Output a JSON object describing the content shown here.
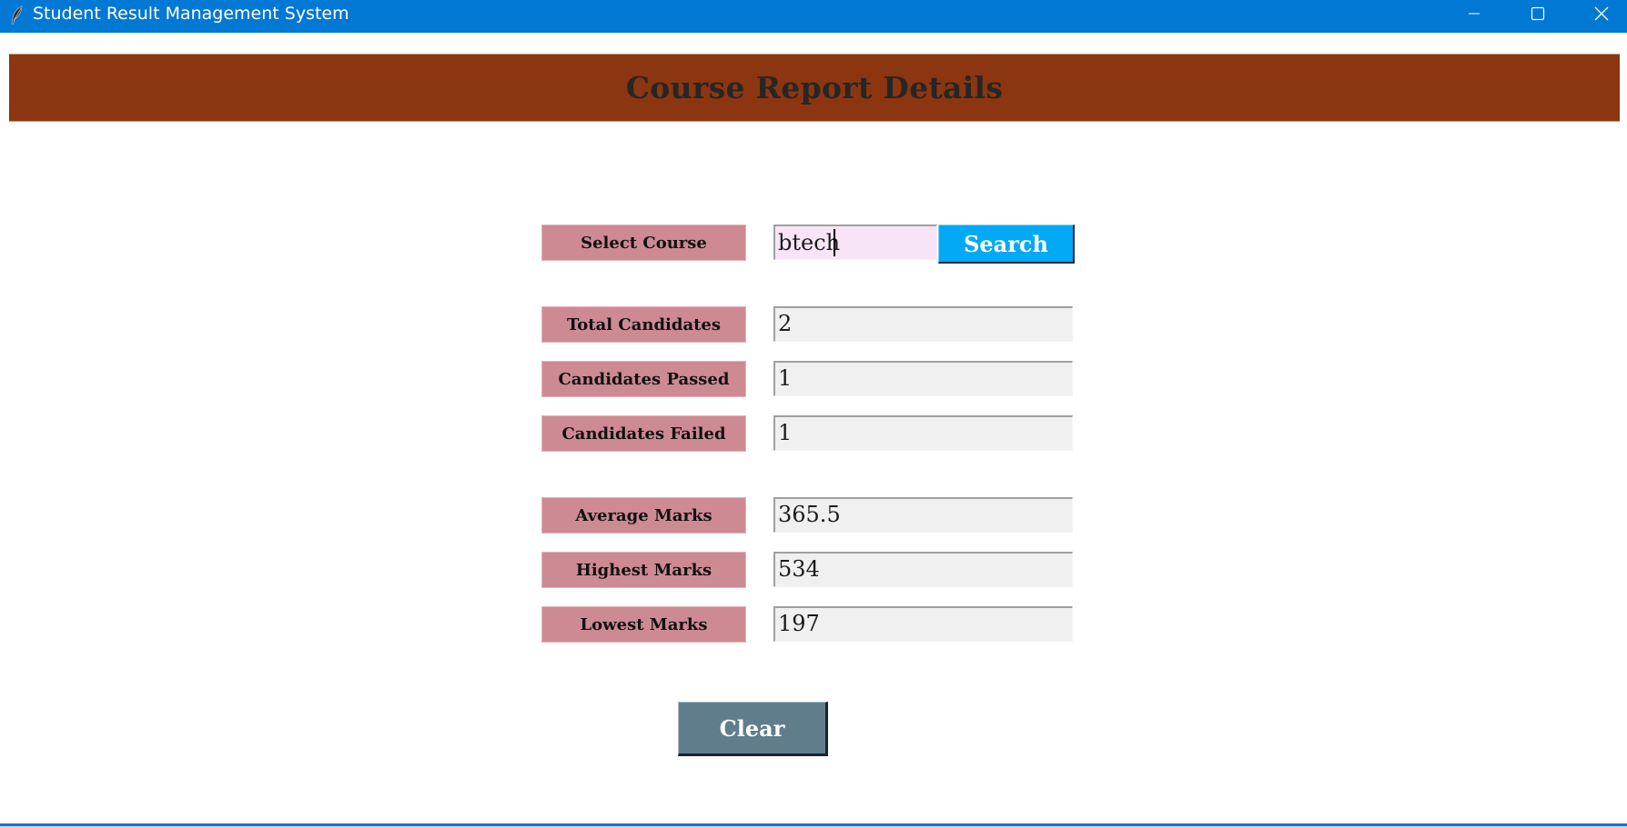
{
  "window": {
    "title": "Student Result Management System",
    "app_icon": "feather-icon",
    "controls": {
      "minimize_icon": "minimize-icon",
      "maximize_icon": "maximize-icon",
      "close_icon": "close-icon"
    },
    "titlebar_color": "#0078D4"
  },
  "header": {
    "title": "Course Report Details",
    "background": "#8B3610"
  },
  "search": {
    "label": "Select Course",
    "value": "btech",
    "button_label": "Search",
    "button_color": "#03A9F4"
  },
  "stats": [
    {
      "label": "Total Candidates",
      "value": "2"
    },
    {
      "label": "Candidates Passed",
      "value": "1"
    },
    {
      "label": "Candidates Failed",
      "value": "1"
    },
    {
      "label": "Average Marks",
      "value": "365.5"
    },
    {
      "label": "Highest Marks",
      "value": "534"
    },
    {
      "label": "Lowest Marks",
      "value": "197"
    }
  ],
  "actions": {
    "clear_label": "Clear",
    "clear_color": "#607D8B"
  },
  "label_color": "#CD8A92"
}
